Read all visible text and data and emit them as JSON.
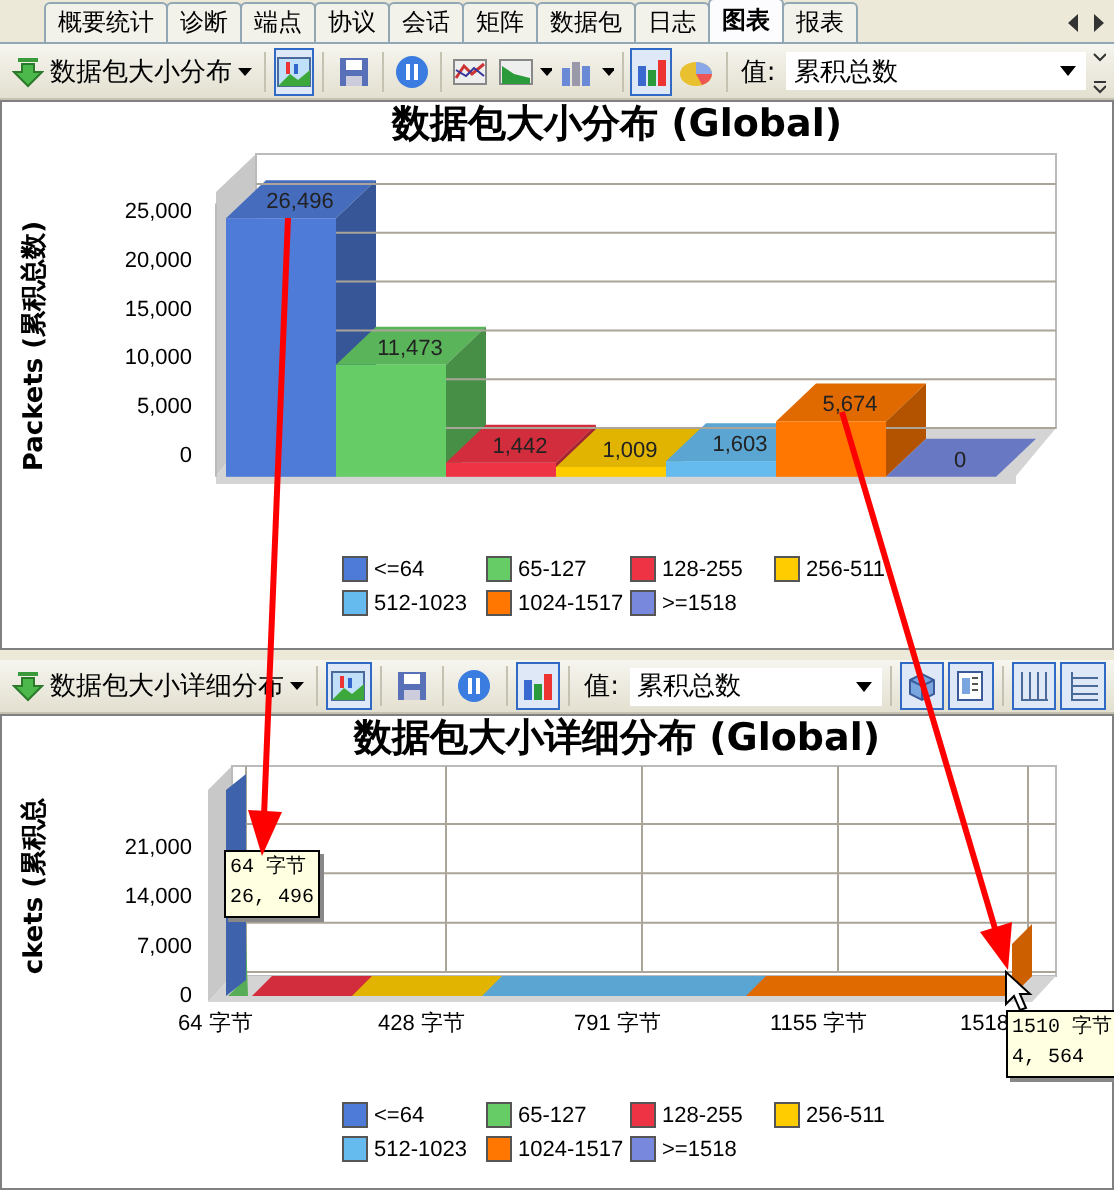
{
  "tabs": [
    {
      "label": "概要统计",
      "selected": false
    },
    {
      "label": "诊断",
      "selected": false
    },
    {
      "label": "端点",
      "selected": false
    },
    {
      "label": "协议",
      "selected": false
    },
    {
      "label": "会话",
      "selected": false
    },
    {
      "label": "矩阵",
      "selected": false
    },
    {
      "label": "数据包",
      "selected": false
    },
    {
      "label": "日志",
      "selected": false
    },
    {
      "label": "图表",
      "selected": true
    },
    {
      "label": "报表",
      "selected": false
    }
  ],
  "panels": [
    {
      "toolbar": {
        "report": "数据包大小分布",
        "items": [
          {
            "kind": "separator"
          },
          {
            "kind": "view",
            "pressed": true
          },
          {
            "kind": "separator"
          },
          {
            "kind": "save",
            "pressed": false
          },
          {
            "kind": "separator"
          },
          {
            "kind": "pause",
            "pressed": false
          },
          {
            "kind": "separator"
          },
          {
            "kind": "line",
            "pressed": false
          },
          {
            "kind": "area",
            "pressed": false,
            "menu": true
          },
          {
            "kind": "bar3d",
            "pressed": false,
            "menu": true
          },
          {
            "kind": "separator"
          },
          {
            "kind": "bar",
            "pressed": true
          },
          {
            "kind": "pie",
            "pressed": false
          },
          {
            "kind": "separator"
          }
        ],
        "value_label": "值:",
        "value": "累积总数"
      },
      "kind": "bar3d",
      "chart_data": {
        "type": "bar",
        "title": "数据包大小分布 (Global)",
        "ylabel": "Packets (累积总数)",
        "grid": true,
        "categories": [
          null,
          null,
          null,
          null,
          null,
          null,
          null
        ],
        "ylim": [
          0,
          28000
        ],
        "values": [
          26496,
          11473,
          1442,
          1009,
          1603,
          5674,
          0
        ],
        "yticks": [
          {
            "value": 0,
            "label": "0"
          },
          {
            "value": 5000,
            "label": "5,000"
          },
          {
            "value": 10000,
            "label": "10,000"
          },
          {
            "value": 15000,
            "label": "15,000"
          },
          {
            "value": 20000,
            "label": "20,000"
          },
          {
            "value": 25000,
            "label": "25,000"
          }
        ],
        "value_labels": [
          "26,496",
          "11,473",
          "1,442",
          "1,009",
          "1,603",
          "5,674",
          "0"
        ]
      },
      "legend": [
        {
          "label": "<=64",
          "color": "#4f7bd8"
        },
        {
          "label": "65-127",
          "color": "#66cc66"
        },
        {
          "label": "128-255",
          "color": "#ee3344"
        },
        {
          "label": "256-511",
          "color": "#ffcc00"
        },
        {
          "label": "512-1023",
          "color": "#66bbee"
        },
        {
          "label": "1024-1517",
          "color": "#ff7700"
        },
        {
          "label": ">=1518",
          "color": "#7788dd"
        }
      ]
    },
    {
      "toolbar": {
        "report": "数据包大小详细分布",
        "items": [
          {
            "kind": "separator"
          },
          {
            "kind": "view",
            "pressed": true
          },
          {
            "kind": "separator"
          },
          {
            "kind": "save",
            "pressed": false
          },
          {
            "kind": "separator"
          },
          {
            "kind": "pause",
            "pressed": false
          },
          {
            "kind": "separator"
          },
          {
            "kind": "bar",
            "pressed": true
          },
          {
            "kind": "separator"
          }
        ],
        "value_label": "值:",
        "value": "累积总数",
        "extra": [
          {
            "kind": "separator"
          },
          {
            "kind": "cube",
            "pressed": true
          },
          {
            "kind": "page",
            "pressed": true
          },
          {
            "kind": "separator"
          },
          {
            "kind": "vgrid",
            "pressed": true
          },
          {
            "kind": "hgrid",
            "pressed": true
          }
        ]
      },
      "kind": "histogram",
      "title": "数据包大小详细分布 (Global)",
      "ylabel": "ckets (累积总",
      "yticks": [
        "21,000",
        "14,000",
        "7,000",
        "0"
      ],
      "xticks": [
        "64 字节",
        "428 字节",
        "791 字节",
        "1155 字节",
        "1518"
      ],
      "tooltips": [
        {
          "lines": [
            "64 字节",
            "26, 496"
          ]
        },
        {
          "lines": [
            "1510 字节",
            "4, 564"
          ]
        }
      ],
      "legend": [
        {
          "label": "<=64",
          "color": "#4f7bd8"
        },
        {
          "label": "65-127",
          "color": "#66cc66"
        },
        {
          "label": "128-255",
          "color": "#ee3344"
        },
        {
          "label": "256-511",
          "color": "#ffcc00"
        },
        {
          "label": "512-1023",
          "color": "#66bbee"
        },
        {
          "label": "1024-1517",
          "color": "#ff7700"
        },
        {
          "label": ">=1518",
          "color": "#7788dd"
        }
      ]
    }
  ]
}
